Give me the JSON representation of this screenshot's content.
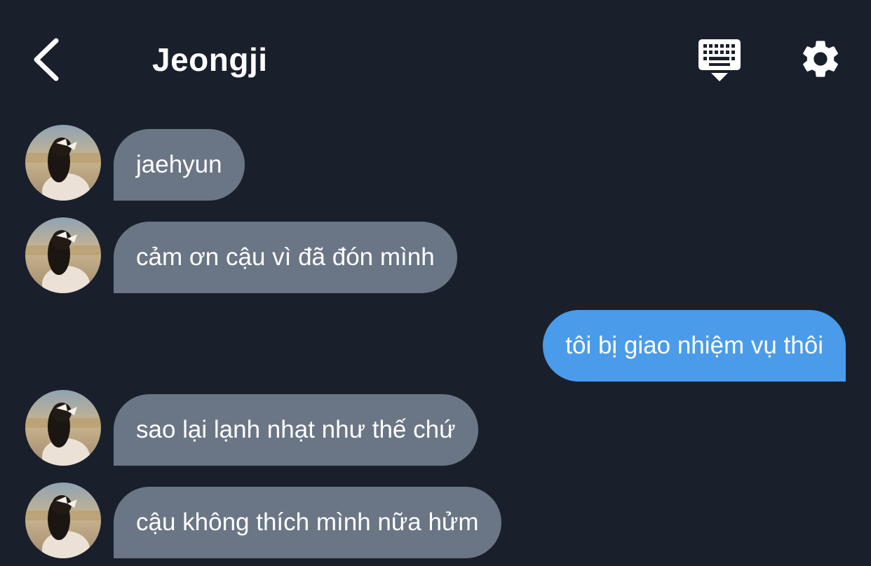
{
  "header": {
    "title": "Jeongji",
    "back_icon": "chevron-left-icon",
    "keyboard_icon": "keyboard-hide-icon",
    "settings_icon": "gear-icon"
  },
  "colors": {
    "background": "#19202b",
    "incoming_bubble": "#6a7685",
    "outgoing_bubble": "#4a9bea",
    "text": "#ffffff"
  },
  "messages": [
    {
      "sender": "contact",
      "text": "jaehyun"
    },
    {
      "sender": "contact",
      "text": "cảm ơn cậu vì đã đón mình"
    },
    {
      "sender": "me",
      "text": "tôi bị giao nhiệm vụ thôi"
    },
    {
      "sender": "contact",
      "text": "sao lại lạnh nhạt như thế chứ"
    },
    {
      "sender": "contact",
      "text": "cậu không thích mình nữa hửm"
    }
  ]
}
